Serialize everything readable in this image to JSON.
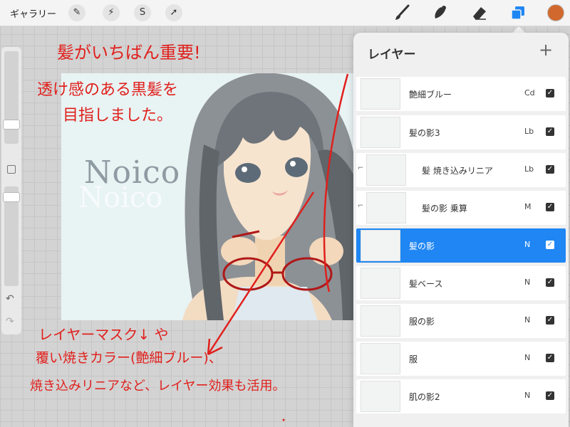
{
  "toolbar": {
    "gallery_label": "ギャラリー",
    "left_tools": [
      {
        "icon": "wrench-icon",
        "glyph": "✎"
      },
      {
        "icon": "magic-wand-icon",
        "glyph": "⚡"
      },
      {
        "icon": "selection-icon",
        "glyph": "S"
      },
      {
        "icon": "transform-arrow-icon",
        "glyph": "➚"
      }
    ],
    "right_tools": [
      "brush-icon",
      "smudge-icon",
      "eraser-icon",
      "layers-icon"
    ],
    "active_color": "#d1692e",
    "accent_color": "#1f86f3"
  },
  "canvas": {
    "watermark": "Noico"
  },
  "annotations": {
    "line1": "髪がいちばん重要!",
    "line2": "透け感のある黒髪を",
    "line3": "目指しました。",
    "line4": "レイヤーマスク↓ や",
    "line5": "覆い焼きカラー(艶細ブルー)、",
    "line6": "焼き込みリニアなど、レイヤー効果も活用。"
  },
  "layers_panel": {
    "title": "レイヤー",
    "add_label": "+",
    "layers": [
      {
        "name": "艶細ブルー",
        "blend": "Cd",
        "visible": true,
        "clipped": false,
        "selected": false
      },
      {
        "name": "髪の影3",
        "blend": "Lb",
        "visible": true,
        "clipped": false,
        "selected": false
      },
      {
        "name": "髪 焼き込みリニア",
        "blend": "Lb",
        "visible": true,
        "clipped": true,
        "selected": false
      },
      {
        "name": "髪の影 乗算",
        "blend": "M",
        "visible": true,
        "clipped": true,
        "selected": false
      },
      {
        "name": "髪の影",
        "blend": "N",
        "visible": true,
        "clipped": false,
        "selected": true
      },
      {
        "name": "髪ベース",
        "blend": "N",
        "visible": true,
        "clipped": false,
        "selected": false
      },
      {
        "name": "服の影",
        "blend": "N",
        "visible": true,
        "clipped": false,
        "selected": false
      },
      {
        "name": "服",
        "blend": "N",
        "visible": true,
        "clipped": false,
        "selected": false
      },
      {
        "name": "肌の影2",
        "blend": "N",
        "visible": true,
        "clipped": false,
        "selected": false
      }
    ]
  }
}
